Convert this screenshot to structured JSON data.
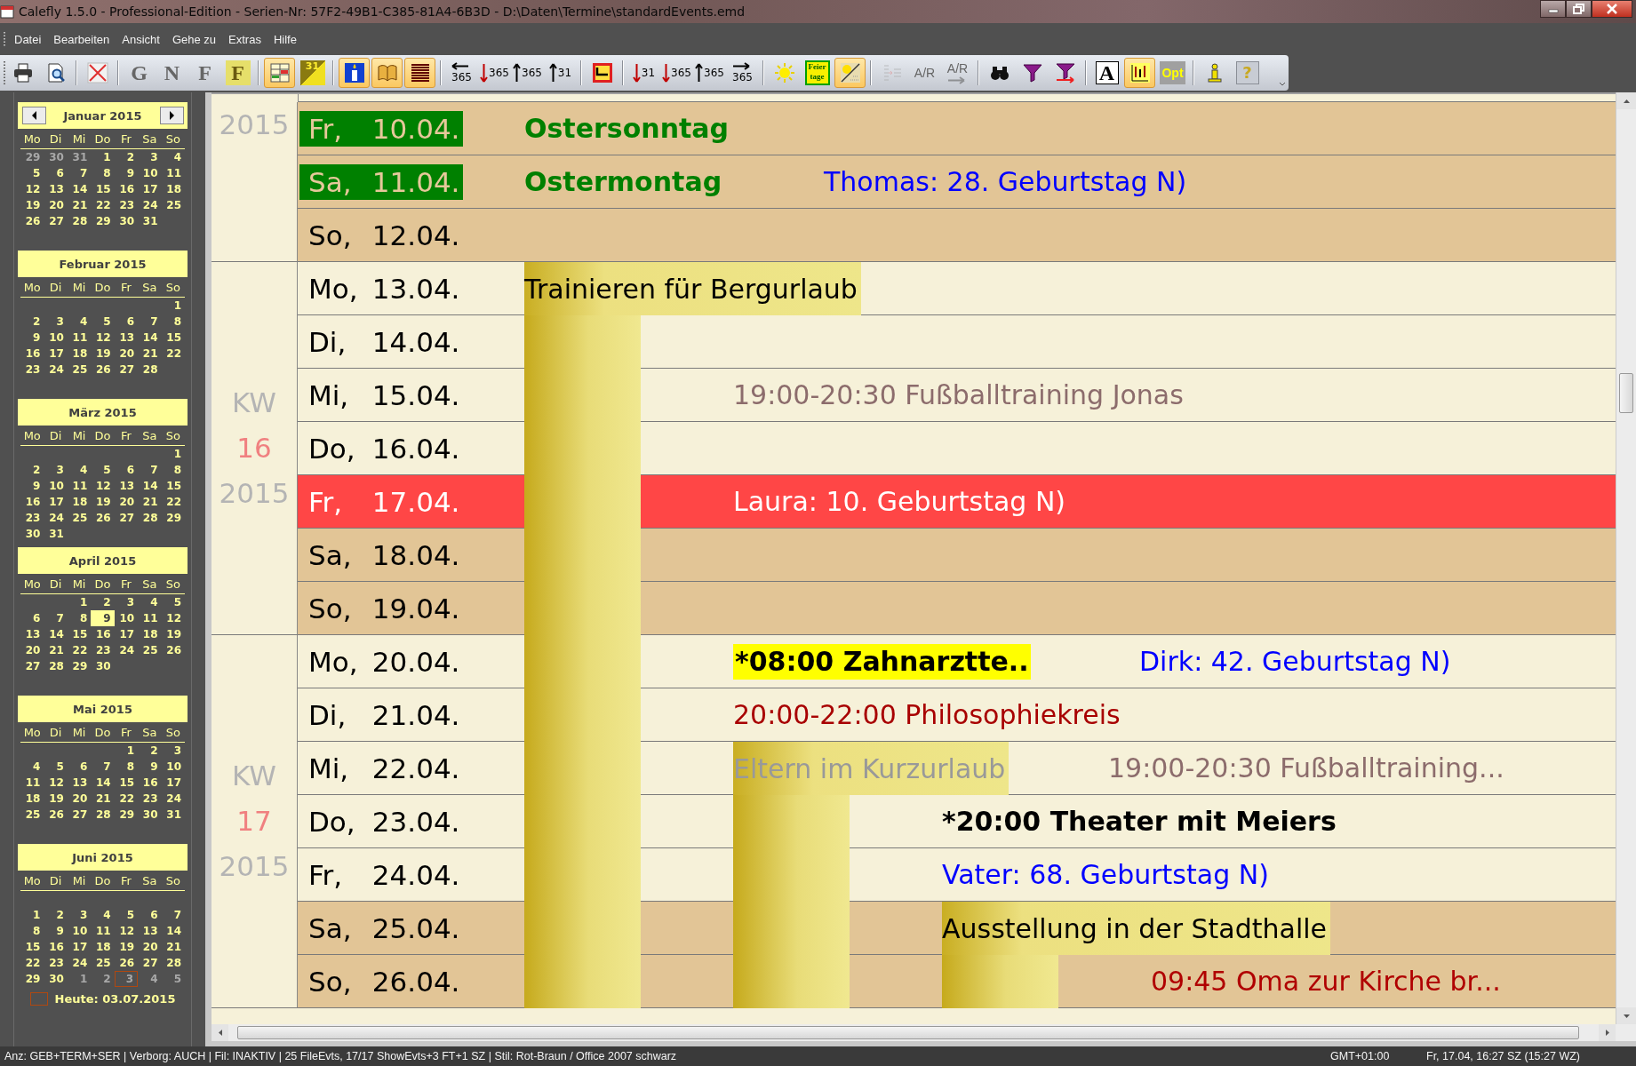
{
  "window": {
    "title": "Calefly 1.5.0 - Professional-Edition - Serien-Nr: 57F2-49B1-C385-81A4-6B3D - D:\\Daten\\Termine\\standardEvents.emd"
  },
  "menu": [
    "Datei",
    "Bearbeiten",
    "Ansicht",
    "Gehe zu",
    "Extras",
    "Hilfe"
  ],
  "toolbar": [
    [
      {
        "kind": "printer",
        "active": false,
        "disabled": false
      },
      {
        "kind": "preview",
        "active": false,
        "disabled": false
      }
    ],
    [
      {
        "kind": "delete",
        "active": false,
        "disabled": false
      }
    ],
    [
      {
        "kind": "letter",
        "label": "G",
        "active": false,
        "disabled": true
      },
      {
        "kind": "letter",
        "label": "N",
        "active": false,
        "disabled": true
      },
      {
        "kind": "letter",
        "label": "F",
        "active": false,
        "disabled": true
      },
      {
        "kind": "letter-box",
        "label": "F",
        "active": false,
        "disabled": false
      }
    ],
    [
      {
        "kind": "grid-view",
        "active": true,
        "disabled": false
      },
      {
        "kind": "day-flag",
        "label": "31",
        "active": false,
        "disabled": false
      }
    ],
    [
      {
        "kind": "candle",
        "active": true,
        "disabled": false
      },
      {
        "kind": "book",
        "active": true,
        "disabled": false
      },
      {
        "kind": "stripes",
        "active": true,
        "disabled": false
      }
    ],
    [
      {
        "kind": "jump-left",
        "label": "365",
        "active": false,
        "disabled": false
      },
      {
        "kind": "jump-down",
        "label": "365",
        "active": false,
        "disabled": false
      },
      {
        "kind": "jump-up",
        "label": "365",
        "active": false,
        "disabled": false
      },
      {
        "kind": "jump-up",
        "label": "31",
        "active": false,
        "disabled": false
      }
    ],
    [
      {
        "kind": "frame",
        "active": false,
        "disabled": false
      }
    ],
    [
      {
        "kind": "jump-down",
        "label": "31",
        "active": false,
        "disabled": false
      },
      {
        "kind": "jump-down",
        "label": "365",
        "active": false,
        "disabled": false
      },
      {
        "kind": "jump-up",
        "label": "365",
        "active": false,
        "disabled": false
      },
      {
        "kind": "jump-right",
        "label": "365",
        "active": false,
        "disabled": false
      }
    ],
    [
      {
        "kind": "sun",
        "active": false,
        "disabled": false
      },
      {
        "kind": "holidays",
        "label": "Feier tage",
        "active": false,
        "disabled": false
      },
      {
        "kind": "sun-grid",
        "active": true,
        "disabled": false
      }
    ],
    [
      {
        "kind": "indent",
        "active": false,
        "disabled": true
      },
      {
        "kind": "ar",
        "label": "A/R",
        "active": false,
        "disabled": true
      },
      {
        "kind": "ar-arrow",
        "label": "A/R",
        "active": false,
        "disabled": true
      }
    ],
    [
      {
        "kind": "binoculars",
        "active": false,
        "disabled": false
      },
      {
        "kind": "filter",
        "active": false,
        "disabled": false
      },
      {
        "kind": "filter-arrow",
        "active": false,
        "disabled": false
      }
    ],
    [
      {
        "kind": "font",
        "label": "A",
        "active": false,
        "disabled": false
      },
      {
        "kind": "chart",
        "active": true,
        "disabled": false
      },
      {
        "kind": "opt",
        "label": "Opt",
        "active": false,
        "disabled": false
      }
    ],
    [
      {
        "kind": "info",
        "active": false,
        "disabled": false
      },
      {
        "kind": "help",
        "label": "?",
        "active": false,
        "disabled": false
      }
    ]
  ],
  "sidebar": {
    "months": [
      {
        "title": "Januar 2015",
        "nav": true,
        "blank_first_week": false,
        "weekdays": [
          "Mo",
          "Di",
          "Mi",
          "Do",
          "Fr",
          "Sa",
          "So"
        ],
        "weeks": [
          [
            {
              "n": "29",
              "kind": "muted"
            },
            {
              "n": "30",
              "kind": "muted"
            },
            {
              "n": "31",
              "kind": "muted"
            },
            {
              "n": "1",
              "kind": "day"
            },
            {
              "n": "2",
              "kind": "day"
            },
            {
              "n": "3",
              "kind": "day"
            },
            {
              "n": "4",
              "kind": "day"
            }
          ],
          [
            {
              "n": "5",
              "kind": "day"
            },
            {
              "n": "6",
              "kind": "day"
            },
            {
              "n": "7",
              "kind": "day"
            },
            {
              "n": "8",
              "kind": "day"
            },
            {
              "n": "9",
              "kind": "day"
            },
            {
              "n": "10",
              "kind": "day"
            },
            {
              "n": "11",
              "kind": "day"
            }
          ],
          [
            {
              "n": "12",
              "kind": "day"
            },
            {
              "n": "13",
              "kind": "day"
            },
            {
              "n": "14",
              "kind": "day"
            },
            {
              "n": "15",
              "kind": "day"
            },
            {
              "n": "16",
              "kind": "day"
            },
            {
              "n": "17",
              "kind": "day"
            },
            {
              "n": "18",
              "kind": "day"
            }
          ],
          [
            {
              "n": "19",
              "kind": "day"
            },
            {
              "n": "20",
              "kind": "day"
            },
            {
              "n": "21",
              "kind": "day"
            },
            {
              "n": "22",
              "kind": "day"
            },
            {
              "n": "23",
              "kind": "day"
            },
            {
              "n": "24",
              "kind": "day"
            },
            {
              "n": "25",
              "kind": "day"
            }
          ],
          [
            {
              "n": "26",
              "kind": "day"
            },
            {
              "n": "27",
              "kind": "day"
            },
            {
              "n": "28",
              "kind": "day"
            },
            {
              "n": "29",
              "kind": "day"
            },
            {
              "n": "30",
              "kind": "day"
            },
            {
              "n": "31",
              "kind": "day"
            }
          ]
        ]
      },
      {
        "title": "Februar 2015",
        "nav": false,
        "blank_first_week": false,
        "weekdays": [
          "Mo",
          "Di",
          "Mi",
          "Do",
          "Fr",
          "Sa",
          "So"
        ],
        "weeks": [
          [
            {
              "n": "1",
              "kind": "day"
            }
          ],
          [
            {
              "n": "2",
              "kind": "day"
            },
            {
              "n": "3",
              "kind": "day"
            },
            {
              "n": "4",
              "kind": "day"
            },
            {
              "n": "5",
              "kind": "day"
            },
            {
              "n": "6",
              "kind": "day"
            },
            {
              "n": "7",
              "kind": "day"
            },
            {
              "n": "8",
              "kind": "day"
            }
          ],
          [
            {
              "n": "9",
              "kind": "day"
            },
            {
              "n": "10",
              "kind": "day"
            },
            {
              "n": "11",
              "kind": "day"
            },
            {
              "n": "12",
              "kind": "day"
            },
            {
              "n": "13",
              "kind": "day"
            },
            {
              "n": "14",
              "kind": "day"
            },
            {
              "n": "15",
              "kind": "day"
            }
          ],
          [
            {
              "n": "16",
              "kind": "day"
            },
            {
              "n": "17",
              "kind": "day"
            },
            {
              "n": "18",
              "kind": "day"
            },
            {
              "n": "19",
              "kind": "day"
            },
            {
              "n": "20",
              "kind": "day"
            },
            {
              "n": "21",
              "kind": "day"
            },
            {
              "n": "22",
              "kind": "day"
            }
          ],
          [
            {
              "n": "23",
              "kind": "day"
            },
            {
              "n": "24",
              "kind": "day"
            },
            {
              "n": "25",
              "kind": "day"
            },
            {
              "n": "26",
              "kind": "day"
            },
            {
              "n": "27",
              "kind": "day"
            },
            {
              "n": "28",
              "kind": "day"
            }
          ]
        ]
      },
      {
        "title": "März 2015",
        "nav": false,
        "blank_first_week": false,
        "weekdays": [
          "Mo",
          "Di",
          "Mi",
          "Do",
          "Fr",
          "Sa",
          "So"
        ],
        "weeks": [
          [
            {
              "n": "1",
              "kind": "day"
            }
          ],
          [
            {
              "n": "2",
              "kind": "day"
            },
            {
              "n": "3",
              "kind": "day"
            },
            {
              "n": "4",
              "kind": "day"
            },
            {
              "n": "5",
              "kind": "day"
            },
            {
              "n": "6",
              "kind": "day"
            },
            {
              "n": "7",
              "kind": "day"
            },
            {
              "n": "8",
              "kind": "day"
            }
          ],
          [
            {
              "n": "9",
              "kind": "day"
            },
            {
              "n": "10",
              "kind": "day"
            },
            {
              "n": "11",
              "kind": "day"
            },
            {
              "n": "12",
              "kind": "day"
            },
            {
              "n": "13",
              "kind": "day"
            },
            {
              "n": "14",
              "kind": "day"
            },
            {
              "n": "15",
              "kind": "day"
            }
          ],
          [
            {
              "n": "16",
              "kind": "day"
            },
            {
              "n": "17",
              "kind": "day"
            },
            {
              "n": "18",
              "kind": "day"
            },
            {
              "n": "19",
              "kind": "day"
            },
            {
              "n": "20",
              "kind": "day"
            },
            {
              "n": "21",
              "kind": "day"
            },
            {
              "n": "22",
              "kind": "day"
            }
          ],
          [
            {
              "n": "23",
              "kind": "day"
            },
            {
              "n": "24",
              "kind": "day"
            },
            {
              "n": "25",
              "kind": "day"
            },
            {
              "n": "26",
              "kind": "day"
            },
            {
              "n": "27",
              "kind": "day"
            },
            {
              "n": "28",
              "kind": "day"
            },
            {
              "n": "29",
              "kind": "day"
            }
          ],
          [
            {
              "n": "30",
              "kind": "day"
            },
            {
              "n": "31",
              "kind": "day"
            }
          ]
        ]
      },
      {
        "title": "April 2015",
        "nav": false,
        "blank_first_week": false,
        "weekdays": [
          "Mo",
          "Di",
          "Mi",
          "Do",
          "Fr",
          "Sa",
          "So"
        ],
        "weeks": [
          [
            {
              "n": "1",
              "kind": "day"
            },
            {
              "n": "2",
              "kind": "day"
            },
            {
              "n": "3",
              "kind": "day"
            },
            {
              "n": "4",
              "kind": "day"
            },
            {
              "n": "5",
              "kind": "day"
            }
          ],
          [
            {
              "n": "6",
              "kind": "day"
            },
            {
              "n": "7",
              "kind": "day"
            },
            {
              "n": "8",
              "kind": "day"
            },
            {
              "n": "9",
              "kind": "selected"
            },
            {
              "n": "10",
              "kind": "day"
            },
            {
              "n": "11",
              "kind": "day"
            },
            {
              "n": "12",
              "kind": "day"
            }
          ],
          [
            {
              "n": "13",
              "kind": "day"
            },
            {
              "n": "14",
              "kind": "day"
            },
            {
              "n": "15",
              "kind": "day"
            },
            {
              "n": "16",
              "kind": "day"
            },
            {
              "n": "17",
              "kind": "day"
            },
            {
              "n": "18",
              "kind": "day"
            },
            {
              "n": "19",
              "kind": "day"
            }
          ],
          [
            {
              "n": "20",
              "kind": "day"
            },
            {
              "n": "21",
              "kind": "day"
            },
            {
              "n": "22",
              "kind": "day"
            },
            {
              "n": "23",
              "kind": "day"
            },
            {
              "n": "24",
              "kind": "day"
            },
            {
              "n": "25",
              "kind": "day"
            },
            {
              "n": "26",
              "kind": "day"
            }
          ],
          [
            {
              "n": "27",
              "kind": "day"
            },
            {
              "n": "28",
              "kind": "day"
            },
            {
              "n": "29",
              "kind": "day"
            },
            {
              "n": "30",
              "kind": "day"
            }
          ]
        ]
      },
      {
        "title": "Mai 2015",
        "nav": false,
        "blank_first_week": false,
        "weekdays": [
          "Mo",
          "Di",
          "Mi",
          "Do",
          "Fr",
          "Sa",
          "So"
        ],
        "weeks": [
          [
            {
              "n": "1",
              "kind": "day"
            },
            {
              "n": "2",
              "kind": "day"
            },
            {
              "n": "3",
              "kind": "day"
            }
          ],
          [
            {
              "n": "4",
              "kind": "day"
            },
            {
              "n": "5",
              "kind": "day"
            },
            {
              "n": "6",
              "kind": "day"
            },
            {
              "n": "7",
              "kind": "day"
            },
            {
              "n": "8",
              "kind": "day"
            },
            {
              "n": "9",
              "kind": "day"
            },
            {
              "n": "10",
              "kind": "day"
            }
          ],
          [
            {
              "n": "11",
              "kind": "day"
            },
            {
              "n": "12",
              "kind": "day"
            },
            {
              "n": "13",
              "kind": "day"
            },
            {
              "n": "14",
              "kind": "day"
            },
            {
              "n": "15",
              "kind": "day"
            },
            {
              "n": "16",
              "kind": "day"
            },
            {
              "n": "17",
              "kind": "day"
            }
          ],
          [
            {
              "n": "18",
              "kind": "day"
            },
            {
              "n": "19",
              "kind": "day"
            },
            {
              "n": "20",
              "kind": "day"
            },
            {
              "n": "21",
              "kind": "day"
            },
            {
              "n": "22",
              "kind": "day"
            },
            {
              "n": "23",
              "kind": "day"
            },
            {
              "n": "24",
              "kind": "day"
            }
          ],
          [
            {
              "n": "25",
              "kind": "day"
            },
            {
              "n": "26",
              "kind": "day"
            },
            {
              "n": "27",
              "kind": "day"
            },
            {
              "n": "28",
              "kind": "day"
            },
            {
              "n": "29",
              "kind": "day"
            },
            {
              "n": "30",
              "kind": "day"
            },
            {
              "n": "31",
              "kind": "day"
            }
          ]
        ]
      },
      {
        "title": "Juni 2015",
        "nav": false,
        "blank_first_week": true,
        "weekdays": [
          "Mo",
          "Di",
          "Mi",
          "Do",
          "Fr",
          "Sa",
          "So"
        ],
        "weeks": [
          [
            {
              "n": "1",
              "kind": "day"
            },
            {
              "n": "2",
              "kind": "day"
            },
            {
              "n": "3",
              "kind": "day"
            },
            {
              "n": "4",
              "kind": "day"
            },
            {
              "n": "5",
              "kind": "day"
            },
            {
              "n": "6",
              "kind": "day"
            },
            {
              "n": "7",
              "kind": "day"
            }
          ],
          [
            {
              "n": "8",
              "kind": "day"
            },
            {
              "n": "9",
              "kind": "day"
            },
            {
              "n": "10",
              "kind": "day"
            },
            {
              "n": "11",
              "kind": "day"
            },
            {
              "n": "12",
              "kind": "day"
            },
            {
              "n": "13",
              "kind": "day"
            },
            {
              "n": "14",
              "kind": "day"
            }
          ],
          [
            {
              "n": "15",
              "kind": "day"
            },
            {
              "n": "16",
              "kind": "day"
            },
            {
              "n": "17",
              "kind": "day"
            },
            {
              "n": "18",
              "kind": "day"
            },
            {
              "n": "19",
              "kind": "day"
            },
            {
              "n": "20",
              "kind": "day"
            },
            {
              "n": "21",
              "kind": "day"
            }
          ],
          [
            {
              "n": "22",
              "kind": "day"
            },
            {
              "n": "23",
              "kind": "day"
            },
            {
              "n": "24",
              "kind": "day"
            },
            {
              "n": "25",
              "kind": "day"
            },
            {
              "n": "26",
              "kind": "day"
            },
            {
              "n": "27",
              "kind": "day"
            },
            {
              "n": "28",
              "kind": "day"
            }
          ],
          [
            {
              "n": "29",
              "kind": "day"
            },
            {
              "n": "30",
              "kind": "day"
            },
            {
              "n": "1",
              "kind": "muted"
            },
            {
              "n": "2",
              "kind": "muted"
            },
            {
              "n": "3",
              "kind": "today"
            },
            {
              "n": "4",
              "kind": "muted"
            },
            {
              "n": "5",
              "kind": "muted"
            }
          ]
        ]
      }
    ],
    "today_label": "Heute: 03.07.2015"
  },
  "agenda": {
    "weeks": [
      {
        "year": "2015",
        "days": [
          {
            "day": "Fr,",
            "date": "10.04.",
            "kind": "holiday",
            "lane_1": {
              "kind": "text",
              "text": "Ostersonntag",
              "color": "#008000",
              "bold": true,
              "highlighted": false
            }
          },
          {
            "day": "Sa,",
            "date": "11.04.",
            "kind": "holiday",
            "lane_1": {
              "kind": "text",
              "text": "Ostermontag",
              "color": "#008000",
              "bold": true,
              "highlighted": false
            },
            "lane_3": {
              "kind": "text",
              "text": "Thomas: 28. Geburtstag N)",
              "color": "#0000ff",
              "bold": false,
              "highlighted": false
            }
          },
          {
            "day": "So,",
            "date": "12.04.",
            "kind": "weekend"
          }
        ]
      },
      {
        "kw": "KW",
        "number": "16",
        "year": "2015",
        "days": [
          {
            "day": "Mo,",
            "date": "13.04.",
            "kind": "weekday",
            "lane_1": {
              "kind": "bar-label",
              "text": "Trainieren für Bergurlaub",
              "color": "#000000",
              "bold": false,
              "highlighted": false
            }
          },
          {
            "day": "Di,",
            "date": "14.04.",
            "kind": "weekday",
            "lane_1": {
              "kind": "bar"
            }
          },
          {
            "day": "Mi,",
            "date": "15.04.",
            "kind": "weekday",
            "lane_1": {
              "kind": "bar"
            },
            "lane_2": {
              "kind": "text",
              "text": "19:00-20:30 Fußballtraining Jonas",
              "color": "#8c6c6c",
              "bold": false,
              "highlighted": false
            }
          },
          {
            "day": "Do,",
            "date": "16.04.",
            "kind": "weekday",
            "lane_1": {
              "kind": "bar"
            }
          },
          {
            "day": "Fr,",
            "date": "17.04.",
            "kind": "marked",
            "lane_1": {
              "kind": "bar"
            },
            "lane_2": {
              "kind": "text",
              "text": "Laura: 10. Geburtstag N)",
              "color": "#ffffff",
              "bold": false,
              "highlighted": false
            }
          },
          {
            "day": "Sa,",
            "date": "18.04.",
            "kind": "weekend",
            "lane_1": {
              "kind": "bar"
            }
          },
          {
            "day": "So,",
            "date": "19.04.",
            "kind": "weekend",
            "lane_1": {
              "kind": "bar"
            }
          }
        ]
      },
      {
        "kw": "KW",
        "number": "17",
        "year": "2015",
        "days": [
          {
            "day": "Mo,",
            "date": "20.04.",
            "kind": "weekday",
            "lane_1": {
              "kind": "bar"
            },
            "lane_2": {
              "kind": "text",
              "text": "*08:00 Zahnarztte..",
              "color": "#000000",
              "bold": true,
              "highlighted": true
            },
            "lane_6": {
              "kind": "text",
              "text": "Dirk: 42. Geburtstag N)",
              "color": "#0000ff",
              "bold": false,
              "highlighted": false
            }
          },
          {
            "day": "Di,",
            "date": "21.04.",
            "kind": "weekday",
            "lane_1": {
              "kind": "bar"
            },
            "lane_2": {
              "kind": "text",
              "text": "20:00-22:00 Philosophiekreis",
              "color": "#a80000",
              "bold": false,
              "highlighted": false
            }
          },
          {
            "day": "Mi,",
            "date": "22.04.",
            "kind": "weekday",
            "lane_1": {
              "kind": "bar"
            },
            "lane_2": {
              "kind": "bar-label",
              "text": "Eltern im Kurzurlaub",
              "color": "#999999",
              "bold": false,
              "highlighted": false
            },
            "lane_5": {
              "kind": "text",
              "text": "19:00-20:30 Fußballtraining...",
              "color": "#8c6c6c",
              "bold": false,
              "highlighted": false
            }
          },
          {
            "day": "Do,",
            "date": "23.04.",
            "kind": "weekday",
            "lane_1": {
              "kind": "bar"
            },
            "lane_2": {
              "kind": "bar"
            },
            "lane_4": {
              "kind": "text",
              "text": "*20:00 Theater mit Meiers",
              "color": "#000000",
              "bold": true,
              "highlighted": false
            }
          },
          {
            "day": "Fr,",
            "date": "24.04.",
            "kind": "weekday",
            "lane_1": {
              "kind": "bar"
            },
            "lane_2": {
              "kind": "bar"
            },
            "lane_4": {
              "kind": "text",
              "text": "Vater: 68. Geburtstag N)",
              "color": "#0000ff",
              "bold": false,
              "highlighted": false
            }
          },
          {
            "day": "Sa,",
            "date": "25.04.",
            "kind": "weekend",
            "lane_1": {
              "kind": "bar"
            },
            "lane_2": {
              "kind": "bar"
            },
            "lane_4": {
              "kind": "bar-label",
              "text": "Ausstellung in der Stadthalle",
              "color": "#000000",
              "bold": false,
              "highlighted": false
            }
          },
          {
            "day": "So,",
            "date": "26.04.",
            "kind": "weekend",
            "lane_1": {
              "kind": "bar"
            },
            "lane_2": {
              "kind": "bar"
            },
            "lane_4": {
              "kind": "bar"
            },
            "lane_7": {
              "kind": "text",
              "text": "09:45 Oma zur Kirche br...",
              "color": "#b00000",
              "bold": false,
              "highlighted": false
            }
          }
        ]
      }
    ]
  },
  "status_bar": {
    "info": "Anz: GEB+TERM+SER | Verborg: AUCH | Fil: INAKTIV | 25 FileEvts, 17/17 ShowEvts+3 FT+1 SZ | Stil: Rot-Braun / Office 2007 schwarz",
    "timezone": "GMT+01:00",
    "clock": "Fr, 17.04, 16:27 SZ (15:27 WZ)"
  }
}
